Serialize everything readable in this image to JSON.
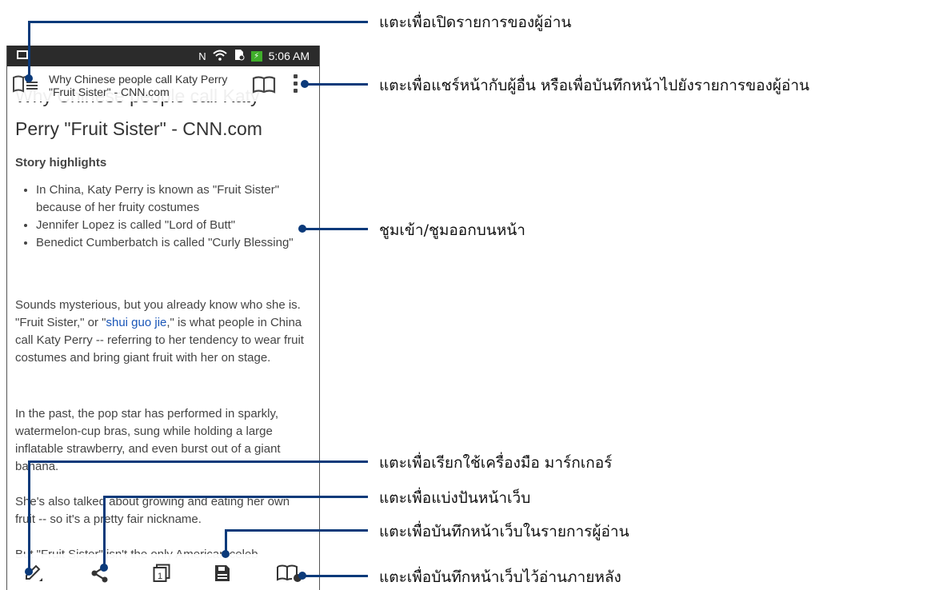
{
  "status_bar": {
    "time": "5:06 AM",
    "nfc": "N"
  },
  "top_bar": {
    "title": "Why Chinese people call Katy Perry \"Fruit Sister\" - CNN.com"
  },
  "article": {
    "headline_hidden": "Why Chinese people call Katy",
    "headline": "Perry \"Fruit Sister\" - CNN.com",
    "story_highlights_label": "Story highlights",
    "highlights": [
      "In China, Katy Perry is known as \"Fruit Sister\" because of her fruity costumes",
      "Jennifer Lopez is called \"Lord of Butt\"",
      "Benedict Cumberbatch is called \"Curly Blessing\""
    ],
    "p1_a": "Sounds mysterious, but you already know who she is. \"Fruit Sister,\" or \"",
    "p1_link": "shui guo jie",
    "p1_b": ",\" is what people in China call Katy Perry -- referring to her tendency to wear fruit costumes and bring giant fruit with her on stage.",
    "p2": "In the past, the pop star has performed in sparkly, watermelon-cup bras, sung while holding a large inflatable strawberry, and even burst out of a giant banana.",
    "p3": "She's also talked about growing and eating her own fruit -- so it's a pretty fair nickname.",
    "p4": "But \"Fruit Sister\" isn't the only American celeb"
  },
  "callouts": {
    "reader_list": "แตะเพื่อเปิดรายการของผู้อ่าน",
    "share_save": "แตะเพื่อแชร์หน้ากับผู้อื่น หรือเพื่อบันทึกหน้าไปยังรายการของผู้อ่าน",
    "zoom": "ชูมเข้า/ชูมออกบนหน้า",
    "marker": "แตะเพื่อเรียกใช้เครื่องมือ มาร์กเกอร์",
    "share_web": "แตะเพื่อแบ่งปันหน้าเว็บ",
    "save_reader": "แตะเพื่อบันทึกหน้าเว็บในรายการผู้อ่าน",
    "read_later": "แตะเพื่อบันทึกหน้าเว็บไว้อ่านภายหลัง"
  },
  "icons": {
    "reader_list": "reader-list-icon",
    "book": "book-icon",
    "menu": "more-vert-icon",
    "marker": "pencil-icon",
    "share": "share-icon",
    "page": "page-icon",
    "save": "save-icon",
    "read_later": "read-later-icon"
  },
  "colors": {
    "accent": "#0b3a7a",
    "link": "#1a56b8",
    "battery": "#3fae2a"
  }
}
